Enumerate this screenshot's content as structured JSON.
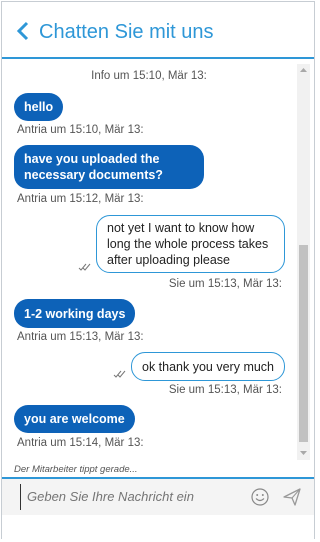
{
  "header": {
    "title": "Chatten Sie mit uns"
  },
  "messages": {
    "info": "Info um 15:10, Mär 13:",
    "items": [
      {
        "from": "agent",
        "text": "hello",
        "meta": "Antria um 15:10, Mär 13:"
      },
      {
        "from": "agent",
        "text": "have you uploaded the necessary documents?",
        "meta": "Antria um 15:12, Mär 13:"
      },
      {
        "from": "user",
        "text": "not yet I want to know how long the whole process takes after uploading please",
        "meta": "Sie um 15:13, Mär 13:"
      },
      {
        "from": "agent",
        "text": "1-2 working days",
        "meta": "Antria um 15:13, Mär 13:"
      },
      {
        "from": "user",
        "text": "ok thank you very much",
        "meta": "Sie um 15:13, Mär 13:"
      },
      {
        "from": "agent",
        "text": "you are welcome",
        "meta": "Antria um 15:14, Mär 13:"
      }
    ]
  },
  "typing_indicator": "Der Mitarbeiter tippt gerade...",
  "composer": {
    "placeholder": "Geben Sie Ihre Nachricht ein",
    "emoji_icon": "smiley-icon",
    "send_icon": "send-icon"
  },
  "colors": {
    "accent": "#2e97d7",
    "agent_bubble": "#0d62b8"
  }
}
